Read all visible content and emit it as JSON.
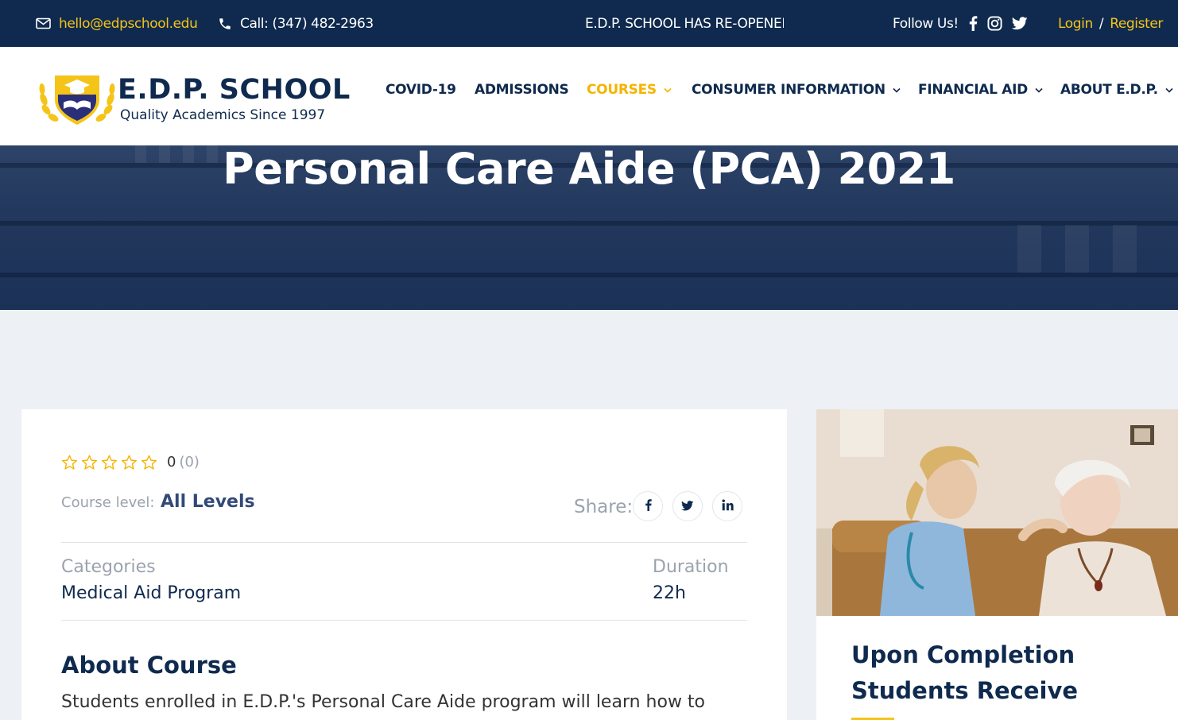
{
  "topbar": {
    "email": "hello@edpschool.edu",
    "phone": "Call: (347) 482-2963",
    "announcement": "E.D.P. SCHOOL HAS RE-OPENED",
    "follow_label": "Follow Us!",
    "login": "Login",
    "separator": "/",
    "register": "Register"
  },
  "logo": {
    "title": "E.D.P. SCHOOL",
    "tagline": "Quality Academics Since 1997"
  },
  "nav": {
    "covid": "COVID-19",
    "admissions": "ADMISSIONS",
    "courses": "COURSES",
    "consumer": "CONSUMER INFORMATION",
    "financial": "FINANCIAL AID",
    "about": "ABOUT E.D.P."
  },
  "hero": {
    "title": "Personal Care Aide (PCA) 2021"
  },
  "course": {
    "rating": {
      "stars_filled": 0,
      "stars_total": 5,
      "value": "0",
      "count": "(0)"
    },
    "level_label": "Course level:",
    "level_value": "All Levels",
    "share_label": "Share:",
    "categories_label": "Categories",
    "categories_value": "Medical Aid Program",
    "duration_label": "Duration",
    "duration_value": "22h",
    "about_title": "About Course",
    "about_text": "Students enrolled in E.D.P.'s Personal Care Aide program will learn how to"
  },
  "sidebar": {
    "title": "Upon Completion Students Receive"
  },
  "colors": {
    "navy": "#0f2a4e",
    "gold": "#f5c419",
    "accent_nav": "#f5b400"
  }
}
